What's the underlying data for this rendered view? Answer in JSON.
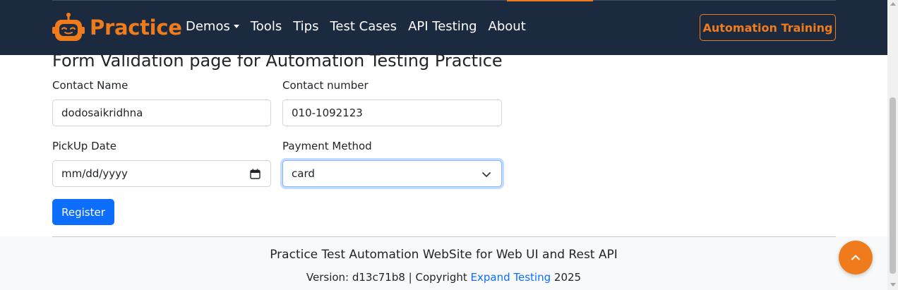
{
  "colors": {
    "navbar_bg": "#1b2a3e",
    "brand_orange": "#f07b1d",
    "primary_blue": "#0d6efd",
    "footer_bg": "#f8f9fa"
  },
  "navbar": {
    "brand": {
      "icon": "robot-logo-icon",
      "text": "Practice"
    },
    "links": [
      {
        "label": "Demos",
        "has_dropdown": true
      },
      {
        "label": "Tools"
      },
      {
        "label": "Tips"
      },
      {
        "label": "Test Cases"
      },
      {
        "label": "API Testing"
      },
      {
        "label": "About"
      }
    ],
    "cta_label": "Automation Training"
  },
  "page": {
    "title": "Form Validation page for Automation Testing Practice"
  },
  "form": {
    "contact_name": {
      "label": "Contact Name",
      "value": "dodosaikridhna"
    },
    "contact_number": {
      "label": "Contact number",
      "value": "010-1092123"
    },
    "pickup_date": {
      "label": "PickUp Date",
      "placeholder": "mm/dd/yyyy",
      "icon": "calendar-icon"
    },
    "payment_method": {
      "label": "Payment Method",
      "selected": "card",
      "icon": "chevron-down-icon"
    },
    "submit_label": "Register"
  },
  "footer": {
    "line1": "Practice Test Automation WebSite for Web UI and Rest API",
    "version_prefix": "Version: d13c71b8 | Copyright ",
    "link_text": "Expand Testing",
    "year": " 2025"
  },
  "scroll_top": {
    "icon": "chevron-up-icon"
  }
}
